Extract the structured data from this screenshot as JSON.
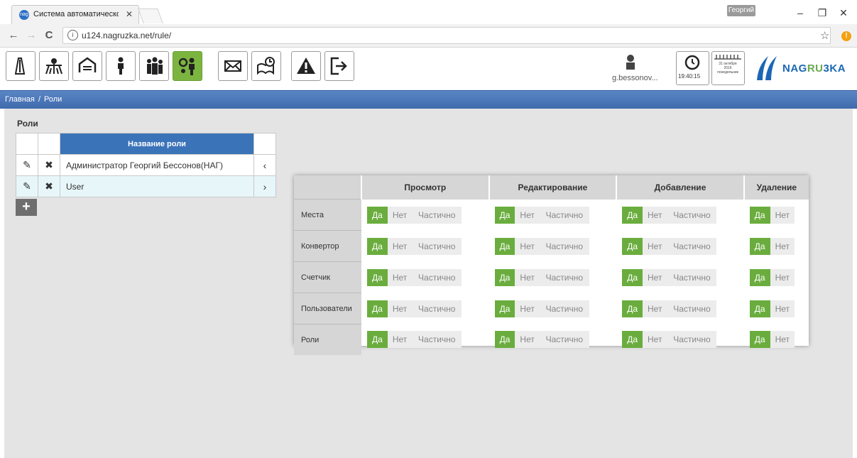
{
  "browser": {
    "tab_title": "Система автоматическо",
    "tab_favicon_text": "nag",
    "tab_close": "✕",
    "user_badge": "Георгий",
    "minimize": "–",
    "restore": "❐",
    "close": "✕",
    "back": "←",
    "forward": "→",
    "reload": "C",
    "info_icon": "i",
    "url": "u124.nagruzka.net/rule/",
    "bookmark": "☆",
    "extension": "!"
  },
  "app": {
    "user_name": "g.bessonov...",
    "clock_time": "19:40:15",
    "calendar_text": "31 октября 2016 понедельник",
    "logo_prefix": "NAG",
    "logo_green": "RU",
    "logo_suffix": "3KA",
    "toolbar_icons": [
      "places-icon",
      "network-icon",
      "converter-icon",
      "user-icon",
      "users-icon",
      "roles-icon",
      "mail-icon",
      "reports-icon",
      "alert-icon",
      "logout-icon"
    ],
    "accent": "#7cb440",
    "brand_blue": "#1b67b5"
  },
  "breadcrumb": {
    "home": "Главная",
    "separator": "/",
    "current": "Роли"
  },
  "roles": {
    "title": "Роли",
    "column_header": "Название роли",
    "rows": [
      {
        "name": "Администратор Георгий Бессонов(НАГ)",
        "arrow": "‹"
      },
      {
        "name": "User",
        "arrow": "›"
      }
    ],
    "edit_glyph": "✎",
    "delete_glyph": "✖",
    "add": "+"
  },
  "permissions": {
    "headers": [
      "Просмотр",
      "Редактирование",
      "Добавление",
      "Удаление"
    ],
    "option_yes": "Да",
    "option_no": "Нет",
    "option_partial": "Частично",
    "rows": [
      "Места",
      "Конвертор",
      "Счетчик",
      "Пользователи",
      "Роли"
    ],
    "selected": "Да"
  }
}
